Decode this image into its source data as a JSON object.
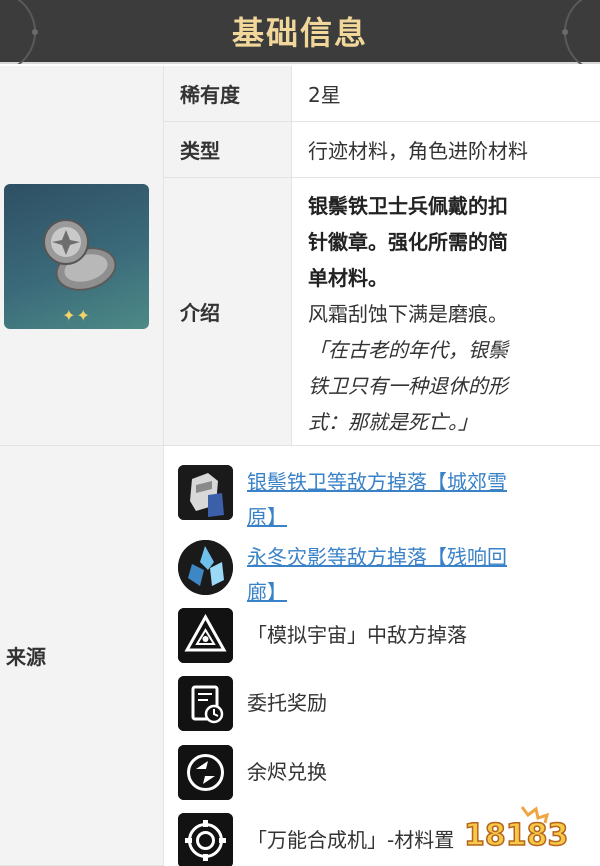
{
  "header": {
    "title": "基础信息"
  },
  "info": {
    "rarity_label": "稀有度",
    "rarity_value": "2星",
    "type_label": "类型",
    "type_value": "行迹材料，角色进阶材料",
    "intro_label": "介绍",
    "intro_bold_1": "银鬃铁卫士兵佩戴的扣",
    "intro_bold_2": "针徽章。强化所需的简",
    "intro_bold_3": "单材料。",
    "intro_line_1": "风霜刮蚀下满是磨痕。",
    "intro_italic_1": "「在古老的年代，银鬃",
    "intro_italic_2": "铁卫只有一种退休的形",
    "intro_italic_3": "式：那就是死亡。」",
    "stars": "✦✦"
  },
  "source": {
    "label": "来源",
    "items": [
      {
        "icon": "armored-soldier-icon",
        "line1": "银鬃铁卫等敌方掉落【城郊雪",
        "line2": "原】",
        "link": true
      },
      {
        "icon": "ice-crystal-icon",
        "line1": "永冬灾影等敌方掉落【残响回",
        "line2": "廊】",
        "link": true
      },
      {
        "icon": "simulated-universe-icon",
        "line1": "「模拟宇宙」中敌方掉落",
        "line2": "",
        "link": false
      },
      {
        "icon": "commission-icon",
        "line1": "委托奖励",
        "line2": "",
        "link": false
      },
      {
        "icon": "exchange-icon",
        "line1": "余烬兑换",
        "line2": "",
        "link": false
      },
      {
        "icon": "synthesizer-icon",
        "line1": "「万能合成机」-材料置",
        "line2": "",
        "link": false
      }
    ]
  },
  "watermark": {
    "text": "18183"
  },
  "colors": {
    "header_bg": "#3c3c3c",
    "header_text": "#f1d79a",
    "link": "#3a82c8"
  }
}
